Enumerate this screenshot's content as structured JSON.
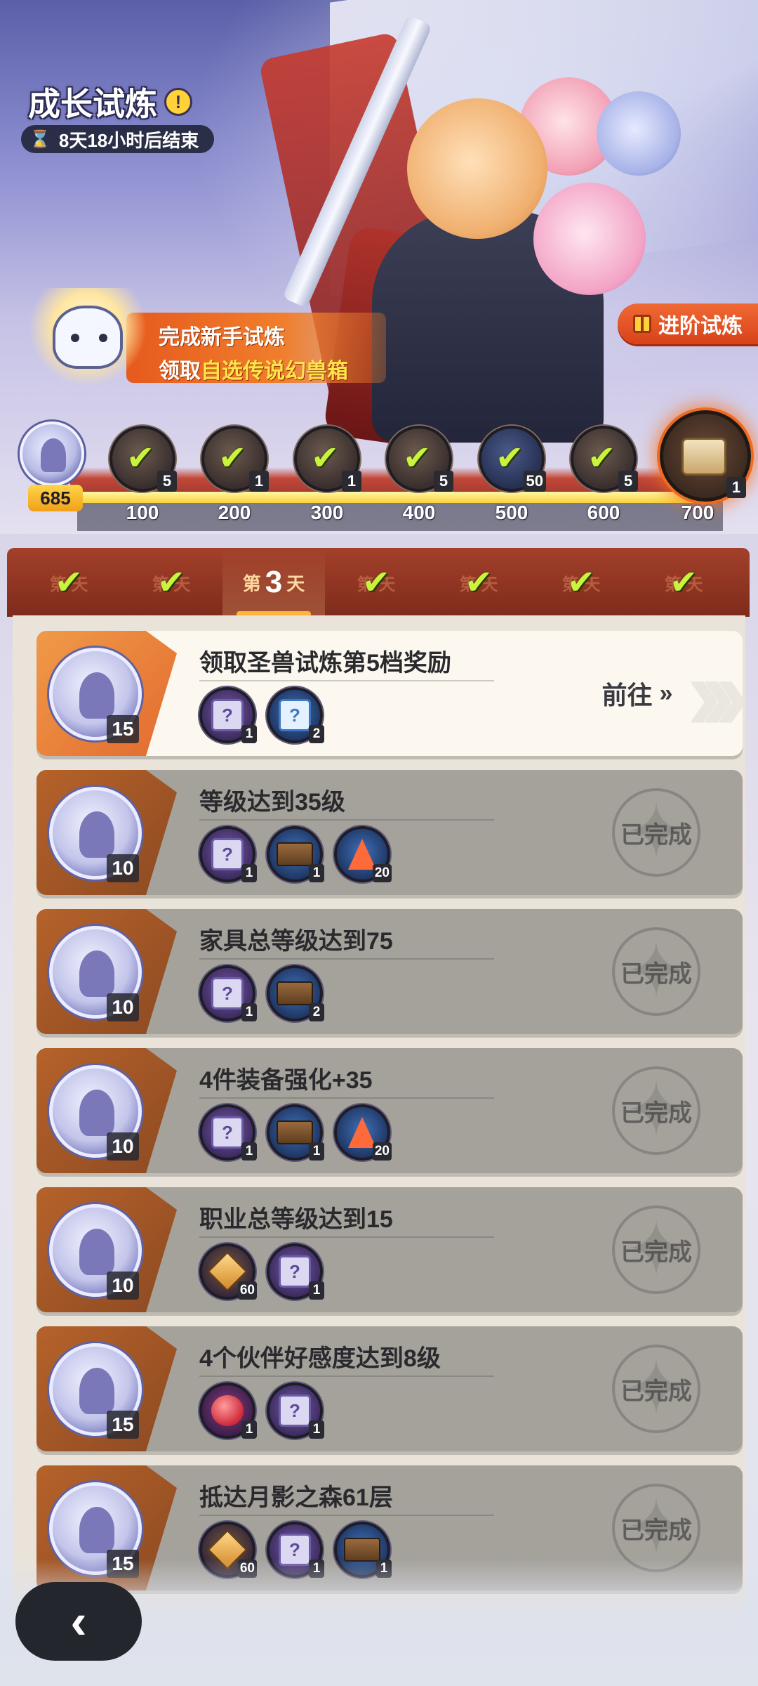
{
  "header": {
    "title": "成长试炼",
    "info_icon": "info-icon",
    "timer_text": "8天18小时后结束"
  },
  "promo": {
    "line1": "完成新手试炼",
    "line2_prefix": "领取",
    "line2_highlight": "自选传说幻兽箱"
  },
  "advanced_button": {
    "label": "进阶试炼",
    "icon": "gift-icon"
  },
  "progress": {
    "current_points": "685",
    "max": 700,
    "current_value": 685,
    "milestones": [
      {
        "threshold": "100",
        "qty": "5",
        "claimed": true
      },
      {
        "threshold": "200",
        "qty": "1",
        "claimed": true
      },
      {
        "threshold": "300",
        "qty": "1",
        "claimed": true
      },
      {
        "threshold": "400",
        "qty": "5",
        "claimed": true
      },
      {
        "threshold": "500",
        "qty": "50",
        "claimed": true
      },
      {
        "threshold": "600",
        "qty": "5",
        "claimed": true
      },
      {
        "threshold": "700",
        "qty": "1",
        "claimed": false
      }
    ]
  },
  "day_tabs": {
    "active_label_prefix": "第",
    "active_number": "3",
    "active_label_suffix": "天",
    "faded_label": "第 天",
    "days": [
      {
        "completed": true
      },
      {
        "completed": true
      },
      {
        "active": true
      },
      {
        "completed": true
      },
      {
        "completed": true
      },
      {
        "completed": true
      },
      {
        "completed": true
      }
    ]
  },
  "tasks": [
    {
      "name": "领取圣兽试炼第5档奖励",
      "points": "15",
      "status": "active",
      "action_label": "前往",
      "rewards": [
        {
          "type": "mystery-gift",
          "qty": "1"
        },
        {
          "type": "blue-gift",
          "qty": "2"
        }
      ]
    },
    {
      "name": "等级达到35级",
      "points": "10",
      "status": "done",
      "action_label": "已完成",
      "rewards": [
        {
          "type": "mystery-gift",
          "qty": "1"
        },
        {
          "type": "crate",
          "qty": "1"
        },
        {
          "type": "crystal",
          "qty": "20"
        }
      ]
    },
    {
      "name": "家具总等级达到75",
      "points": "10",
      "status": "done",
      "action_label": "已完成",
      "rewards": [
        {
          "type": "mystery-gift",
          "qty": "1"
        },
        {
          "type": "crate",
          "qty": "2"
        }
      ]
    },
    {
      "name": "4件装备强化+35",
      "points": "10",
      "status": "done",
      "action_label": "已完成",
      "rewards": [
        {
          "type": "mystery-gift",
          "qty": "1"
        },
        {
          "type": "crate",
          "qty": "1"
        },
        {
          "type": "crystal",
          "qty": "20"
        }
      ]
    },
    {
      "name": "职业总等级达到15",
      "points": "10",
      "status": "done",
      "action_label": "已完成",
      "rewards": [
        {
          "type": "shard",
          "qty": "60"
        },
        {
          "type": "mystery-gift",
          "qty": "1"
        }
      ]
    },
    {
      "name": "4个伙伴好感度达到8级",
      "points": "15",
      "status": "done",
      "action_label": "已完成",
      "rewards": [
        {
          "type": "apple",
          "qty": "1"
        },
        {
          "type": "mystery-gift",
          "qty": "1"
        }
      ]
    },
    {
      "name": "抵达月影之森61层",
      "points": "15",
      "status": "done",
      "action_label": "已完成",
      "rewards": [
        {
          "type": "shard",
          "qty": "60"
        },
        {
          "type": "mystery-gift",
          "qty": "1"
        },
        {
          "type": "crate",
          "qty": "1"
        }
      ]
    }
  ],
  "back_button": {
    "icon": "back-arrow-icon"
  }
}
